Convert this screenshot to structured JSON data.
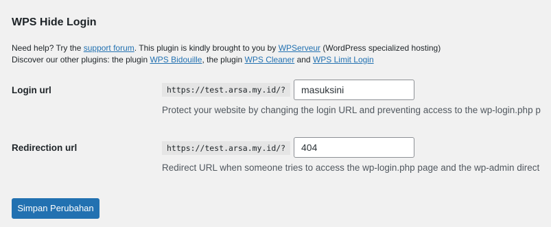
{
  "section": {
    "title": "WPS Hide Login"
  },
  "help": {
    "line1_prefix": "Need help? Try the ",
    "support_link": "support forum",
    "line1_middle": ". This plugin is kindly brought to you by ",
    "wpserveur_link": "WPServeur",
    "line1_suffix": " (WordPress specialized hosting)",
    "line2_prefix": "Discover our other plugins: the plugin ",
    "bidouille_link": "WPS Bidouille",
    "line2_middle": ", the plugin ",
    "cleaner_link": "WPS Cleaner",
    "line2_and": " and ",
    "limit_login_link": "WPS Limit Login"
  },
  "fields": {
    "login_url": {
      "label": "Login url",
      "prefix": "https://test.arsa.my.id/?",
      "value": "masuksini",
      "description": "Protect your website by changing the login URL and preventing access to the wp-login.php p"
    },
    "redirection_url": {
      "label": "Redirection url",
      "prefix": "https://test.arsa.my.id/?",
      "value": "404",
      "description": "Redirect URL when someone tries to access the wp-login.php page and the wp-admin direct"
    }
  },
  "actions": {
    "save_label": "Simpan Perubahan"
  },
  "colors": {
    "link": "#2271b1",
    "button": "#2271b1",
    "background": "#f1f1f1"
  }
}
